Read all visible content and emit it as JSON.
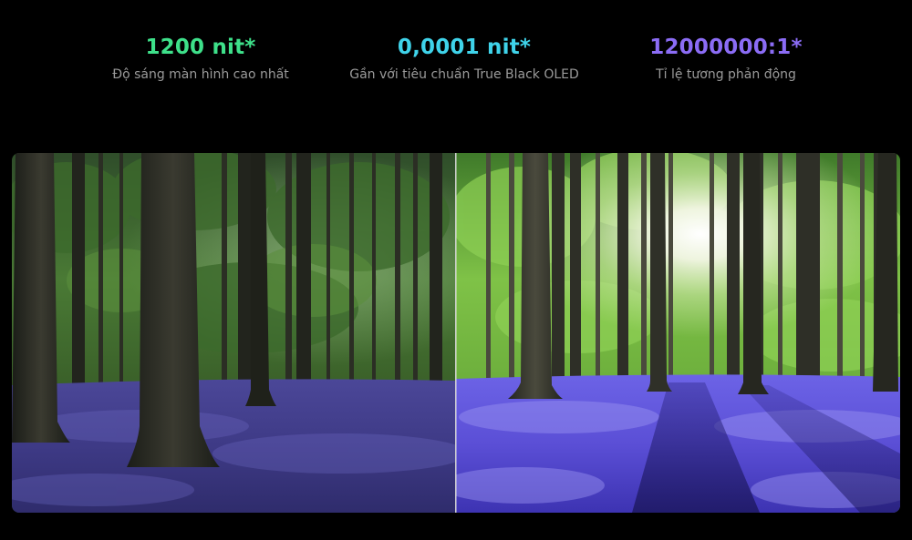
{
  "specs": [
    {
      "value": "1200 nit*",
      "description": "Độ sáng màn hình cao nhất",
      "color": "#3ee08a"
    },
    {
      "value": "0,0001 nit*",
      "description": "Gần với tiêu chuẩn True Black OLED",
      "color": "#3fd3ea"
    },
    {
      "value": "12000000:1*",
      "description": "Tỉ lệ tương phản động",
      "color": "#8b6cf5"
    }
  ],
  "comparison_image": {
    "subject": "bluebell forest with tall trees",
    "left_panel": "standard display (dim)",
    "right_panel": "OLED display (bright, sunlit)",
    "colors": {
      "foliage": "#5fa83a",
      "bluebells": "#5b4fd6",
      "trunks": "#2a2a24",
      "sunlight": "#f4f7e6"
    }
  }
}
